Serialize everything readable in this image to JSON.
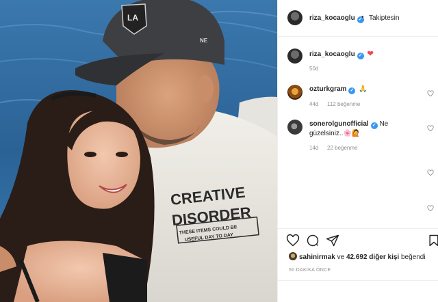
{
  "post": {
    "author": "riza_kocaoglu",
    "follow_status": "Takiptesin",
    "caption_time": "50d",
    "caption_emoji": "❤"
  },
  "shirt": {
    "line1": "CREATIVE",
    "line2": "DISORDER",
    "box_line1": "THESE ITEMS COULD BE",
    "box_line2": "USEFUL DAY TO DAY"
  },
  "cap_logo": "LA",
  "cap_brand": "NE",
  "comments": [
    {
      "user": "ozturkgram",
      "text": "🙏",
      "time": "44d",
      "likes": "112 beğenme"
    },
    {
      "user": "sonerolgunofficial",
      "text_part1": "Ne",
      "text_part2": "güzelsiniz..🌸🙋",
      "time": "14d",
      "likes": "22 beğenme"
    }
  ],
  "likes_line": {
    "user": "sahinirmak",
    "connector": "ve",
    "count": "42.692 diğer kişi",
    "verb": "beğendi"
  },
  "posted_ago": "50 DAKİKA ÖNCE",
  "colors": {
    "verified": "#3897f0",
    "heart": "#ed4956",
    "sea": "#2f6aa0"
  },
  "icons": [
    "verified-icon",
    "heart-icon",
    "comment-icon",
    "share-icon",
    "save-icon",
    "pray-emoji"
  ]
}
